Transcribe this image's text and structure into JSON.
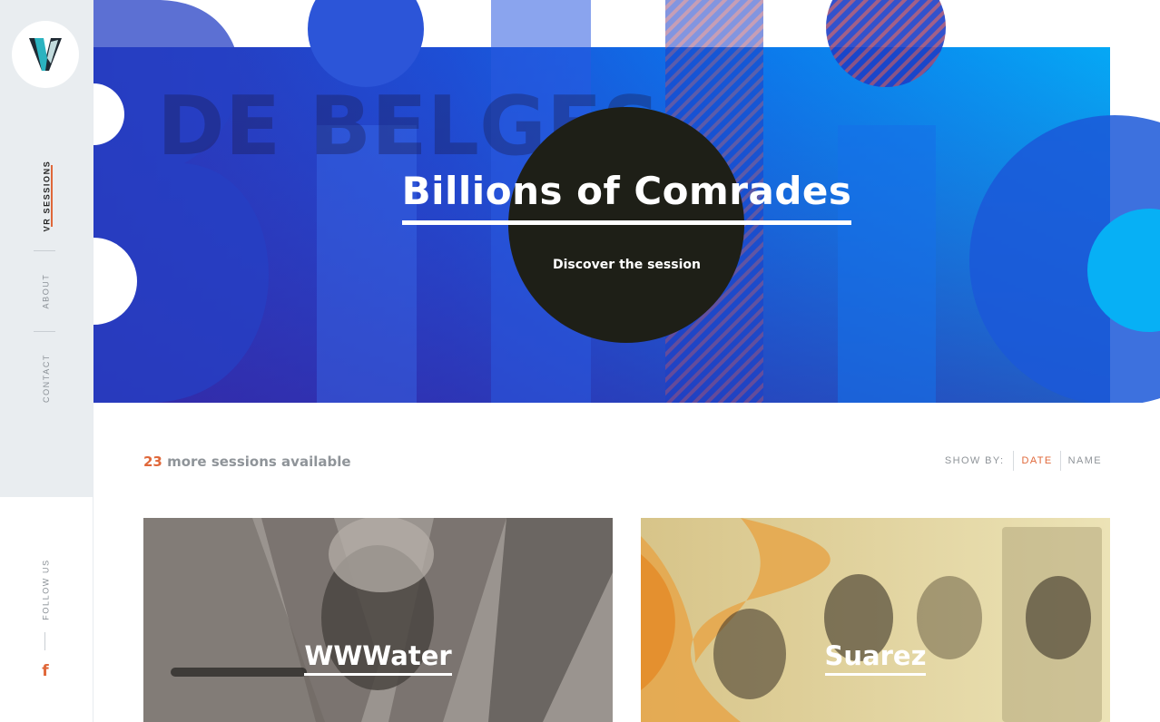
{
  "app": {
    "logo_letter": "V",
    "brand_colors": {
      "teal": "#2bb3c0",
      "dark": "#1f2a33",
      "accent": "#e0683a"
    }
  },
  "sidebar": {
    "nav": [
      {
        "label": "VR Sessions",
        "active": true
      },
      {
        "label": "About",
        "active": false
      },
      {
        "label": "Contact",
        "active": false
      }
    ],
    "follow_label": "Follow us",
    "facebook_icon": "f"
  },
  "hero": {
    "title": "Billions of Comrades",
    "cta": "Discover the session",
    "background_text": "DE BELGES",
    "colors": {
      "blue": "#1f4fe0",
      "sky": "#0aa3f2",
      "circle": "#1e1f17"
    }
  },
  "toolbar": {
    "count_number": "23",
    "count_text": " more sessions available",
    "show_by_label": "Show by:",
    "options": [
      {
        "label": "Date",
        "active": true
      },
      {
        "label": "Name",
        "active": false
      }
    ]
  },
  "sessions": [
    {
      "title": "WWWater"
    },
    {
      "title": "Suarez"
    }
  ]
}
